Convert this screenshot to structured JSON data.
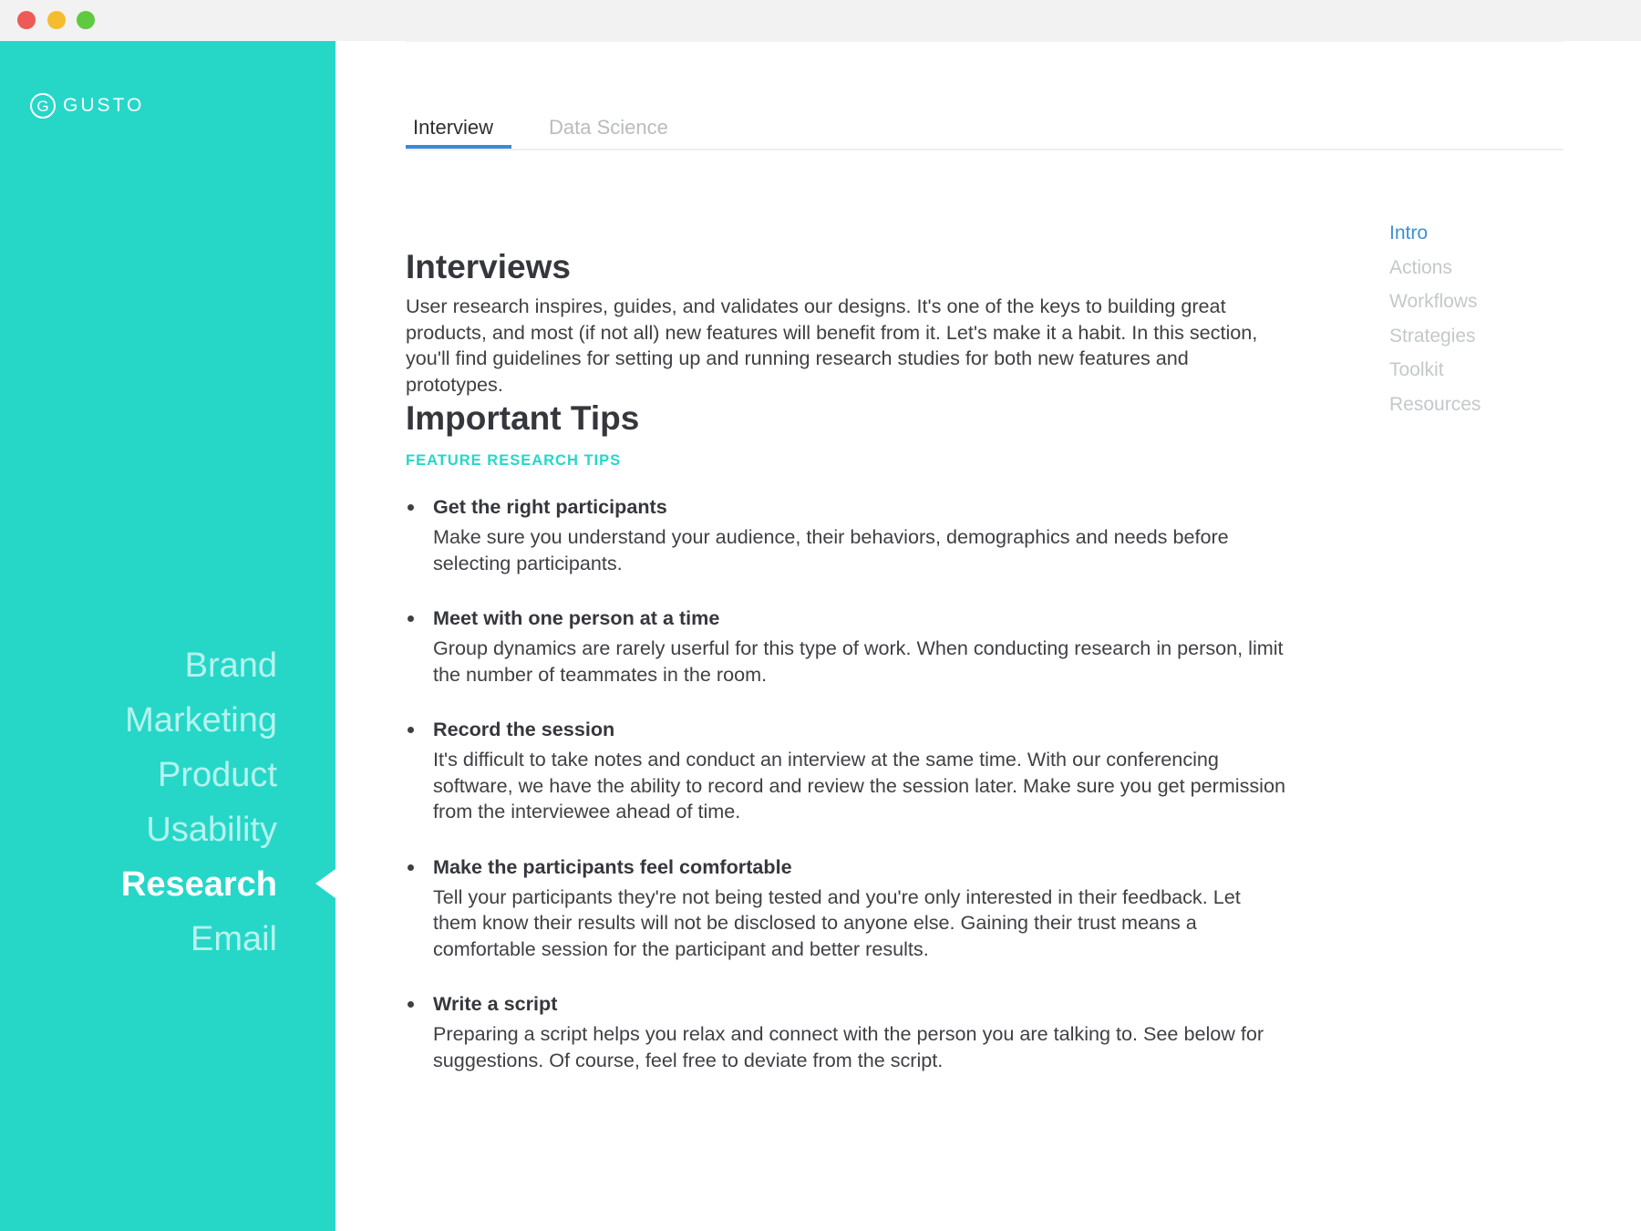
{
  "window": {
    "controls": [
      "close",
      "minimize",
      "zoom"
    ]
  },
  "sidebar": {
    "logo_text": "GUSTO",
    "logo_mark": "G",
    "nav": [
      {
        "label": "Brand",
        "active": false
      },
      {
        "label": "Marketing",
        "active": false
      },
      {
        "label": "Product",
        "active": false
      },
      {
        "label": "Usability",
        "active": false
      },
      {
        "label": "Research",
        "active": true
      },
      {
        "label": "Email",
        "active": false
      }
    ],
    "color": "#26d7c8"
  },
  "tabs": [
    {
      "label": "Interview",
      "active": true
    },
    {
      "label": "Data Science",
      "active": false
    }
  ],
  "toc": [
    {
      "label": "Intro",
      "active": true
    },
    {
      "label": "Actions",
      "active": false
    },
    {
      "label": "Workflows",
      "active": false
    },
    {
      "label": "Strategies",
      "active": false
    },
    {
      "label": "Toolkit",
      "active": false
    },
    {
      "label": "Resources",
      "active": false
    }
  ],
  "article": {
    "title": "Interviews",
    "intro": "User research inspires, guides, and validates our designs. It's one of the keys to building great products, and most (if not all) new features will benefit from it. Let's make it a habit. In this section, you'll find guidelines for setting up and running research studies for both new features and prototypes.",
    "tips_title": "Important Tips",
    "tips_subhead": "FEATURE RESEARCH TIPS",
    "tips": [
      {
        "title": "Get the right participants",
        "body": "Make sure you understand your audience, their behaviors, demographics and needs before selecting participants."
      },
      {
        "title": "Meet with one person at a time",
        "body": "Group dynamics are rarely userful for this type of work. When conducting research in person, limit the number of teammates in the room."
      },
      {
        "title": "Record the session",
        "body": "It's difficult to take notes and conduct an interview at the same time. With our conferencing software, we have the ability to record and review the session later. Make sure you get permission from the interviewee ahead of time."
      },
      {
        "title": "Make the participants feel comfortable",
        "body": "Tell your participants they're not being tested and you're only interested in their feedback. Let them know their results will not be disclosed to anyone else. Gaining their trust means a comfortable session for the participant and better results."
      },
      {
        "title": "Write a script",
        "body": "Preparing a script helps you relax and connect with the person you are talking to. See below for suggestions. Of course, feel free to deviate from the script."
      }
    ]
  },
  "colors": {
    "accent_teal": "#26d7c8",
    "accent_blue": "#3d8fd9",
    "text_dark": "#36373c",
    "text_muted": "#c4c8ca"
  }
}
